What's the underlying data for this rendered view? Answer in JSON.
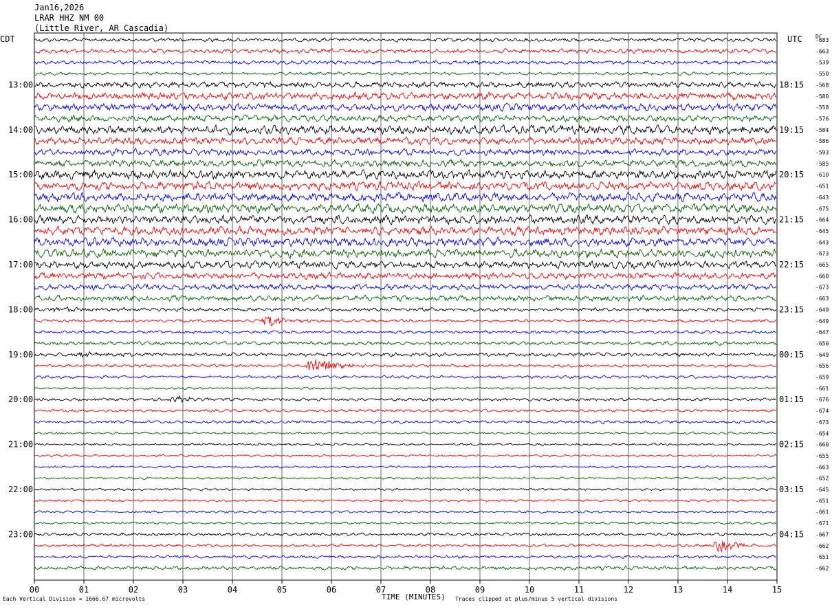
{
  "header": {
    "date": "Jan16,2026",
    "station": "LRAR HHZ NM 00",
    "location": "(Little River, AR Cascadia)"
  },
  "left_tz": "CDT",
  "right_tz": "UTC",
  "dc_label": "DC",
  "footer": {
    "scale_note": "Each Vertical Division = 1666.67 microvolts",
    "xlabel": "TIME (MINUTES)",
    "clip_note": "Traces clipped at plus/minus 5 vertical divisions"
  },
  "chart_data": {
    "type": "line",
    "xlabel": "TIME (MINUTES)",
    "xlim": [
      0,
      15
    ],
    "x_ticks": [
      "00",
      "01",
      "02",
      "03",
      "04",
      "05",
      "06",
      "07",
      "08",
      "09",
      "10",
      "11",
      "12",
      "13",
      "14",
      "15"
    ],
    "trace_colors": [
      "#000000",
      "#ff0000",
      "#0000ff",
      "#006400"
    ],
    "left_time_labels": [
      "13:00",
      "14:00",
      "15:00",
      "16:00",
      "17:00",
      "18:00",
      "19:00",
      "20:00",
      "21:00",
      "22:00",
      "23:00"
    ],
    "right_time_labels": [
      "18:15",
      "19:15",
      "20:15",
      "21:15",
      "22:15",
      "23:15",
      "00:15",
      "01:15",
      "02:15",
      "03:15",
      "04:15"
    ],
    "dc_offsets": [
      "-683",
      "-663",
      "-539",
      "-550",
      "-568",
      "-580",
      "-558",
      "-576",
      "-584",
      "-586",
      "-593",
      "-585",
      "-610",
      "-651",
      "-643",
      "-675",
      "-664",
      "-645",
      "-643",
      "-673",
      "-665",
      "-660",
      "-673",
      "-663",
      "-649",
      "-649",
      "-647",
      "-650",
      "-649",
      "-656",
      "-659",
      "-661",
      "-676",
      "-674",
      "-673",
      "-654",
      "-660",
      "-655",
      "-663",
      "-652",
      "-645",
      "-651",
      "-661",
      "-671",
      "-667",
      "-662",
      "-651",
      "-662"
    ],
    "noise_level_by_trace": [
      2.5,
      3,
      2.5,
      2,
      4,
      5,
      5,
      4.5,
      6,
      5,
      4.5,
      5,
      6,
      6,
      6,
      6,
      6,
      6,
      6,
      6,
      5,
      4.5,
      4,
      4,
      2.5,
      2,
      2,
      2.5,
      2.5,
      2,
      2,
      1.5,
      2,
      2,
      2,
      1.5,
      1.5,
      1.5,
      1.5,
      1.5,
      1.5,
      1.5,
      1.5,
      1.5,
      2,
      2,
      2,
      2.5
    ],
    "events": [
      {
        "trace": 29,
        "minute": 5.6,
        "amplitude": 14
      },
      {
        "trace": 25,
        "minute": 4.7,
        "amplitude": 8
      },
      {
        "trace": 45,
        "minute": 13.8,
        "amplitude": 9
      },
      {
        "trace": 32,
        "minute": 2.8,
        "amplitude": 5
      },
      {
        "trace": 24,
        "minute": 0.4,
        "amplitude": 4
      },
      {
        "trace": 28,
        "minute": 1.0,
        "amplitude": 4
      }
    ]
  }
}
